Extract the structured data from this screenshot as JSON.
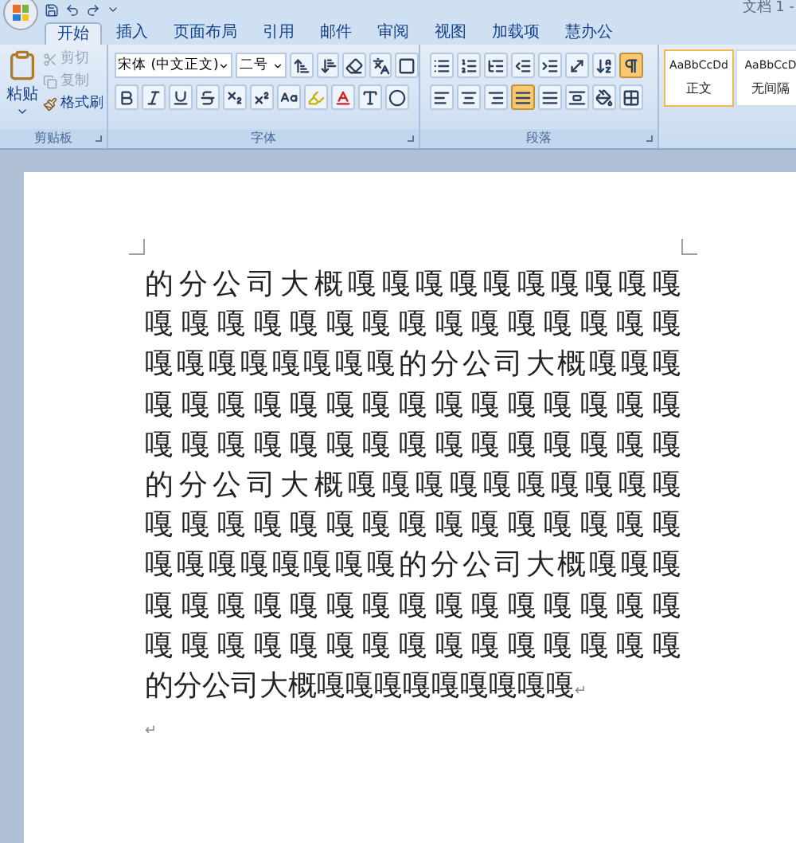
{
  "window": {
    "title": "文档 1 -"
  },
  "tabs": [
    {
      "label": "开始",
      "selected": true
    },
    {
      "label": "插入",
      "selected": false
    },
    {
      "label": "页面布局",
      "selected": false
    },
    {
      "label": "引用",
      "selected": false
    },
    {
      "label": "邮件",
      "selected": false
    },
    {
      "label": "审阅",
      "selected": false
    },
    {
      "label": "视图",
      "selected": false
    },
    {
      "label": "加载项",
      "selected": false
    },
    {
      "label": "慧办公",
      "selected": false
    }
  ],
  "clipboard": {
    "label": "剪贴板",
    "paste": "粘贴",
    "items": [
      {
        "label": "剪切",
        "kind": "cut",
        "disabled": true
      },
      {
        "label": "复制",
        "kind": "copy",
        "disabled": true
      },
      {
        "label": "格式刷",
        "kind": "painter",
        "disabled": false
      }
    ]
  },
  "font": {
    "label": "字体",
    "name": "宋体 (中文正文)",
    "size": "二号",
    "row1": [
      {
        "kind": "grow"
      },
      {
        "kind": "shrink"
      },
      {
        "kind": "clear"
      },
      {
        "kind": "phonetic"
      },
      {
        "kind": "border"
      }
    ],
    "row2": [
      {
        "kind": "bold"
      },
      {
        "kind": "italic"
      },
      {
        "kind": "underline"
      },
      {
        "kind": "strike"
      },
      {
        "kind": "sub"
      },
      {
        "kind": "sup"
      },
      {
        "kind": "case"
      },
      {
        "kind": "highlight"
      },
      {
        "kind": "color"
      },
      {
        "kind": "shade"
      },
      {
        "kind": "enclose"
      }
    ]
  },
  "paragraph": {
    "label": "段落",
    "row1": [
      {
        "kind": "bullets",
        "selected": false
      },
      {
        "kind": "numbering",
        "selected": false
      },
      {
        "kind": "multilevel",
        "selected": false
      },
      {
        "kind": "outdent",
        "selected": false
      },
      {
        "kind": "indent",
        "selected": false
      },
      {
        "kind": "asian",
        "selected": false
      },
      {
        "kind": "sort",
        "selected": false
      },
      {
        "kind": "marks",
        "selected": true
      }
    ],
    "row2": [
      {
        "kind": "left",
        "selected": false
      },
      {
        "kind": "center",
        "selected": false
      },
      {
        "kind": "right",
        "selected": false
      },
      {
        "kind": "justify",
        "selected": true
      },
      {
        "kind": "distribute",
        "selected": false
      },
      {
        "kind": "spacing",
        "selected": false
      },
      {
        "kind": "fill",
        "selected": false
      },
      {
        "kind": "borders",
        "selected": false
      }
    ]
  },
  "styles": [
    {
      "sample": "AaBbCcDd",
      "name": "正文",
      "selected": true
    },
    {
      "sample": "AaBbCcD",
      "name": "无间隔",
      "selected": false
    }
  ],
  "document": {
    "lines": [
      "的分公司大概嘎嘎嘎嘎嘎嘎嘎嘎嘎嘎",
      "嘎嘎嘎嘎嘎嘎嘎嘎嘎嘎嘎嘎嘎嘎嘎",
      "嘎嘎嘎嘎嘎嘎嘎嘎的分公司大概嘎嘎嘎",
      "嘎嘎嘎嘎嘎嘎嘎嘎嘎嘎嘎嘎嘎嘎嘎",
      "嘎嘎嘎嘎嘎嘎嘎嘎嘎嘎嘎嘎嘎嘎嘎",
      "的分公司大概嘎嘎嘎嘎嘎嘎嘎嘎嘎嘎",
      "嘎嘎嘎嘎嘎嘎嘎嘎嘎嘎嘎嘎嘎嘎嘎",
      "嘎嘎嘎嘎嘎嘎嘎嘎的分公司大概嘎嘎嘎",
      "嘎嘎嘎嘎嘎嘎嘎嘎嘎嘎嘎嘎嘎嘎嘎",
      "嘎嘎嘎嘎嘎嘎嘎嘎嘎嘎嘎嘎嘎嘎嘎",
      "的分公司大概嘎嘎嘎嘎嘎嘎嘎嘎嘎"
    ],
    "paragraph_mark": "↵",
    "empty_mark": "↵"
  }
}
